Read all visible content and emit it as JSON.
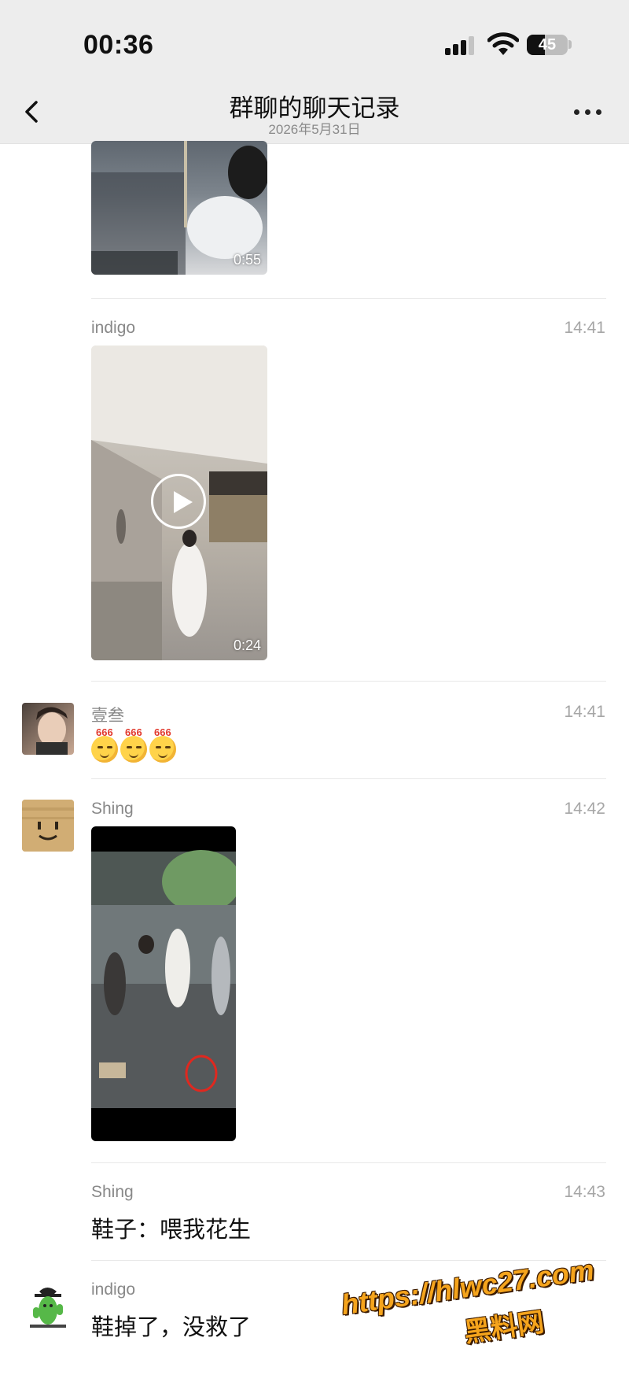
{
  "status_bar": {
    "time": "00:36",
    "battery": "45"
  },
  "nav": {
    "title": "群聊的聊天记录",
    "subtitle": "2026年5月31日"
  },
  "messages": [
    {
      "type": "video",
      "duration": "0:55"
    },
    {
      "sender": "indigo",
      "time": "14:41",
      "type": "video",
      "duration": "0:24"
    },
    {
      "sender": "壹叁",
      "time": "14:41",
      "type": "stickers",
      "sticker_tag": "666"
    },
    {
      "sender": "Shing",
      "time": "14:42",
      "type": "video"
    },
    {
      "sender": "Shing",
      "time": "14:43",
      "type": "text",
      "text": "鞋子：喂我花生"
    },
    {
      "sender": "indigo",
      "time": "",
      "type": "text",
      "text": "鞋掉了，没救了"
    }
  ],
  "watermark": {
    "line1": "https://hlwc27.com",
    "line2": "黑料网"
  },
  "colors": {
    "bar_bg": "#ededed",
    "watermark": "#f5a41c"
  }
}
